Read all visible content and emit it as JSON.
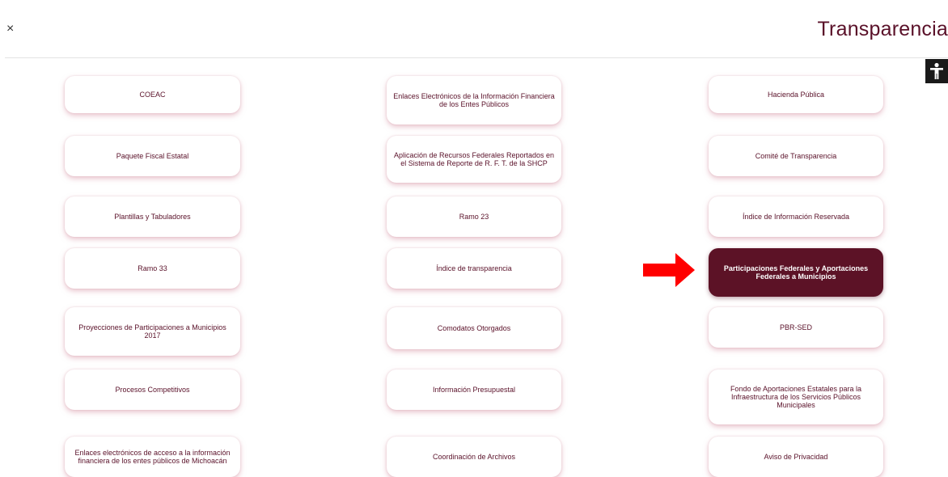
{
  "header": {
    "close_label": "×",
    "title": "Transparencia"
  },
  "accessibility": {
    "icon": "accessibility-icon"
  },
  "tiles": [
    {
      "label": "COEAC",
      "active": false
    },
    {
      "label": "Enlaces Electrónicos de la Información Financiera de los Entes Públicos",
      "active": false
    },
    {
      "label": "Hacienda Pública",
      "active": false
    },
    {
      "label": "Paquete Fiscal Estatal",
      "active": false
    },
    {
      "label": "Aplicación de Recursos Federales Reportados en el Sistema de Reporte de R. F. T. de la SHCP",
      "active": false
    },
    {
      "label": "Comité de Transparencia",
      "active": false
    },
    {
      "label": "Plantillas y Tabuladores",
      "active": false
    },
    {
      "label": "Ramo 23",
      "active": false
    },
    {
      "label": "Índice de Información Reservada",
      "active": false
    },
    {
      "label": "Ramo 33",
      "active": false
    },
    {
      "label": "Índice de transparencia",
      "active": false
    },
    {
      "label": "Participaciones Federales y Aportaciones Federales a Municipios",
      "active": true
    },
    {
      "label": "Proyecciones de Participaciones a Municipios 2017",
      "active": false
    },
    {
      "label": "Comodatos Otorgados",
      "active": false
    },
    {
      "label": "PBR-SED",
      "active": false
    },
    {
      "label": "Procesos Competitivos",
      "active": false
    },
    {
      "label": "Información Presupuestal",
      "active": false
    },
    {
      "label": "Fondo de Aportaciones Estatales para la Infraestructura de los Servicios Públicos Municipales",
      "active": false
    },
    {
      "label": "Enlaces electrónicos de acceso a la información financiera de los entes públicos de Michoacán",
      "active": false
    },
    {
      "label": "Coordinación de Archivos",
      "active": false
    },
    {
      "label": "Aviso de Privacidad",
      "active": false
    }
  ],
  "colors": {
    "brand": "#5a1129",
    "active_tile": "#5c1226",
    "arrow": "#ff0000",
    "a11y_button": "#1a1a1a"
  }
}
